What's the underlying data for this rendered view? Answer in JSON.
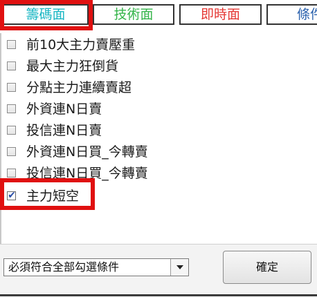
{
  "tabs": [
    {
      "label": "籌碼面",
      "color": "#18b6c3",
      "highlighted": true
    },
    {
      "label": "技術面",
      "color": "#34b449"
    },
    {
      "label": "即時面",
      "color": "#e53935"
    },
    {
      "label": "條件",
      "color": "#2a61ad"
    }
  ],
  "conditions": [
    {
      "label": "前10大主力賣壓重",
      "checked": false
    },
    {
      "label": "最大主力狂倒貨",
      "checked": false
    },
    {
      "label": "分點主力連續賣超",
      "checked": false
    },
    {
      "label": "外資連N日賣",
      "checked": false
    },
    {
      "label": "投信連N日賣",
      "checked": false
    },
    {
      "label": "外資連N日買_今轉賣",
      "checked": false
    },
    {
      "label": "投信連N日買_今轉賣",
      "checked": false
    },
    {
      "label": "主力短空",
      "checked": true,
      "highlighted": true
    }
  ],
  "match_mode": {
    "selected": "必須符合全部勾選條件"
  },
  "confirm_button": {
    "label": "確定"
  },
  "highlight_color": "#e01010"
}
